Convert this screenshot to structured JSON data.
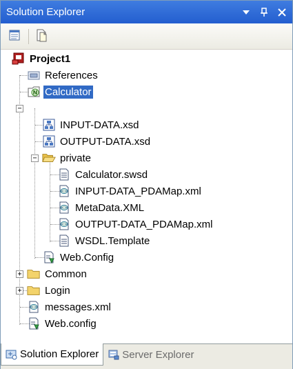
{
  "window": {
    "title": "Solution Explorer",
    "controls": [
      "dropdown-icon",
      "pin-icon",
      "close-icon"
    ]
  },
  "toolbar": {
    "buttons": [
      {
        "name": "properties-button",
        "icon": "properties-icon"
      },
      {
        "name": "show-all-files-button",
        "icon": "show-all-files-icon"
      }
    ]
  },
  "tree": {
    "items": [
      {
        "label": "Project1",
        "icon": "project-icon",
        "level": 0,
        "bold": true
      },
      {
        "label": "References",
        "icon": "references-icon",
        "level": 1
      },
      {
        "label": "Calculator",
        "icon": "service-folder-icon",
        "level": 1,
        "expanded": true,
        "selected": true
      },
      {
        "label": "INPUT-DATA.xsd",
        "icon": "xsd-icon",
        "level": 2
      },
      {
        "label": "OUTPUT-DATA.xsd",
        "icon": "xsd-icon",
        "level": 2
      },
      {
        "label": "private",
        "icon": "open-folder-icon",
        "level": 2,
        "expanded": true
      },
      {
        "label": "Calculator.swsd",
        "icon": "text-file-icon",
        "level": 3
      },
      {
        "label": "INPUT-DATA_PDAMap.xml",
        "icon": "xml-file-icon",
        "level": 3
      },
      {
        "label": "MetaData.XML",
        "icon": "xml-file-icon",
        "level": 3
      },
      {
        "label": "OUTPUT-DATA_PDAMap.xml",
        "icon": "xml-file-icon",
        "level": 3
      },
      {
        "label": "WSDL.Template",
        "icon": "text-file-icon",
        "level": 3
      },
      {
        "label": "Web.Config",
        "icon": "config-file-icon",
        "level": 2
      },
      {
        "label": "Common",
        "icon": "folder-icon",
        "level": 1,
        "collapsed": true
      },
      {
        "label": "Login",
        "icon": "folder-icon",
        "level": 1,
        "collapsed": true
      },
      {
        "label": "messages.xml",
        "icon": "xml-file-icon",
        "level": 1
      },
      {
        "label": "Web.config",
        "icon": "config-file-icon",
        "level": 1
      }
    ]
  },
  "tabs": [
    {
      "label": "Solution Explorer",
      "icon": "solution-explorer-icon",
      "active": true
    },
    {
      "label": "Server Explorer",
      "icon": "server-explorer-icon",
      "active": false
    }
  ],
  "colors": {
    "title_bar": "#2a63d4",
    "selection": "#316ac5",
    "folder": "#f3d36b",
    "tab_bar": "#ecebe3"
  }
}
